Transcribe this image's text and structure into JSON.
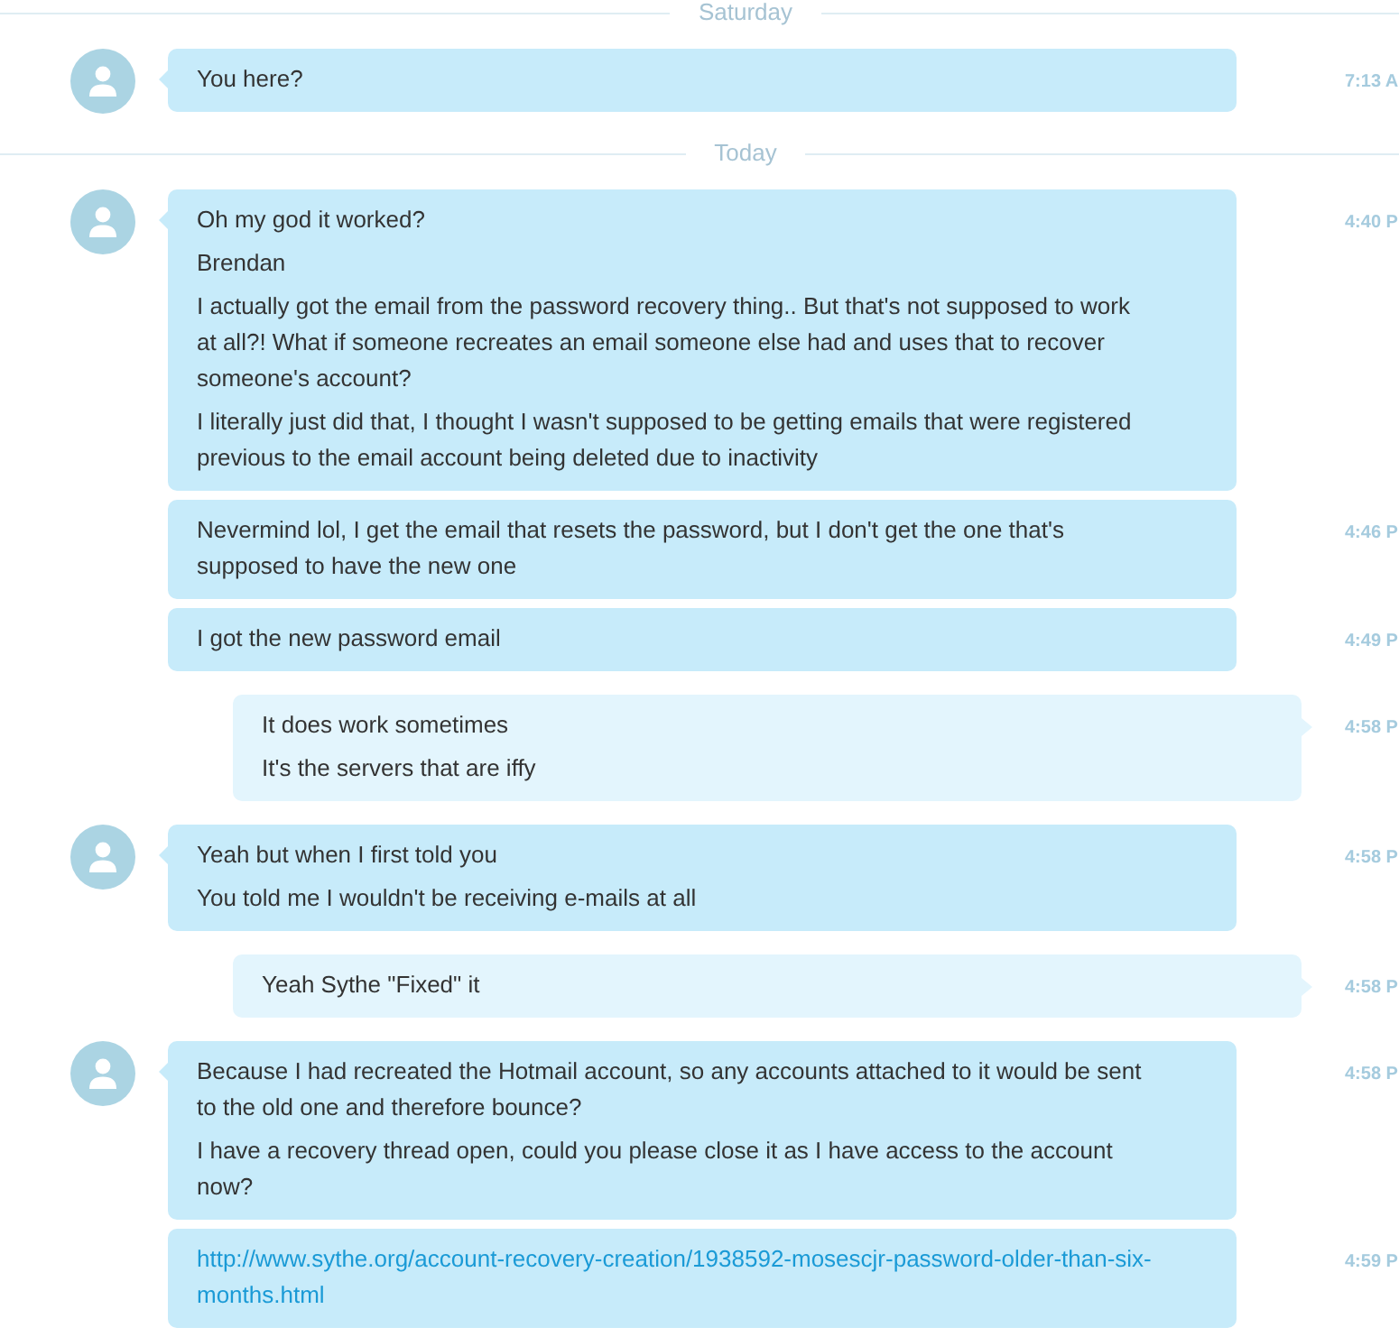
{
  "days": [
    {
      "label": "Saturday",
      "messages": [
        {
          "kind": "received",
          "continued": false,
          "time": "7:13 A",
          "paragraphs": [
            {
              "kind": "text",
              "text": "You here?"
            }
          ]
        }
      ]
    },
    {
      "label": "Today",
      "messages": [
        {
          "kind": "received",
          "continued": false,
          "time": "4:40 P",
          "paragraphs": [
            {
              "kind": "text",
              "text": "Oh my god it worked?"
            },
            {
              "kind": "text",
              "text": "Brendan"
            },
            {
              "kind": "text",
              "text": "I actually got the email from the password recovery thing.. But that's not supposed to work at all?! What if someone recreates an email someone else had and uses that to recover someone's account?"
            },
            {
              "kind": "text",
              "text": "I literally just did that, I thought I wasn't supposed to be getting emails that were registered previous to the email account being deleted due to inactivity"
            }
          ]
        },
        {
          "kind": "received",
          "continued": true,
          "time": "4:46 P",
          "paragraphs": [
            {
              "kind": "text",
              "text": "Nevermind lol, I get the email that resets the password, but I don't get the one that's supposed to have the new one"
            }
          ]
        },
        {
          "kind": "received",
          "continued": true,
          "time": "4:49 P",
          "paragraphs": [
            {
              "kind": "text",
              "text": "I got the new password email"
            }
          ]
        },
        {
          "kind": "sent",
          "continued": false,
          "time": "4:58 P",
          "paragraphs": [
            {
              "kind": "text",
              "text": "It does work sometimes"
            },
            {
              "kind": "text",
              "text": "It's the servers that are iffy"
            }
          ]
        },
        {
          "kind": "received",
          "continued": false,
          "time": "4:58 P",
          "paragraphs": [
            {
              "kind": "text",
              "text": "Yeah but when I first told you"
            },
            {
              "kind": "text",
              "text": "You told me I wouldn't be receiving e-mails at all"
            }
          ]
        },
        {
          "kind": "sent",
          "continued": false,
          "time": "4:58 P",
          "paragraphs": [
            {
              "kind": "text",
              "text": "Yeah Sythe \"Fixed\" it"
            }
          ]
        },
        {
          "kind": "received",
          "continued": false,
          "time": "4:58 P",
          "paragraphs": [
            {
              "kind": "text",
              "text": "Because I had recreated the Hotmail account, so any accounts attached to it would be sent to the old one and therefore bounce?"
            },
            {
              "kind": "text",
              "text": "I have a recovery thread open, could you please close it as I have access to the account now?"
            }
          ]
        },
        {
          "kind": "received",
          "continued": true,
          "time": "4:59 P",
          "paragraphs": [
            {
              "kind": "link",
              "text": "http://www.sythe.org/account-recovery-creation/1938592-mosescjr-password-older-than-six-months.html"
            }
          ]
        }
      ]
    }
  ]
}
